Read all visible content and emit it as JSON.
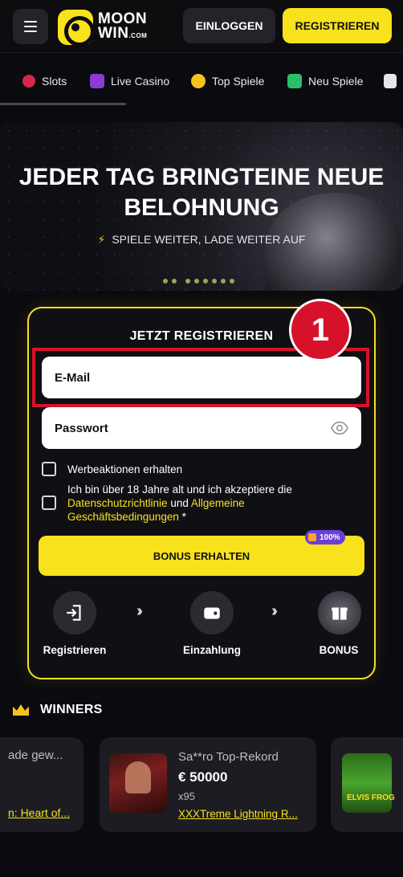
{
  "header": {
    "logo_text": "MOON",
    "logo_text2": "WIN",
    "logo_suffix": ".COM",
    "login_label": "EINLOGGEN",
    "register_label": "REGISTRIEREN"
  },
  "nav": {
    "items": [
      {
        "label": "Slots",
        "icon": "cherries-icon"
      },
      {
        "label": "Live Casino",
        "icon": "play-icon"
      },
      {
        "label": "Top Spiele",
        "icon": "top-games-icon"
      },
      {
        "label": "Neu Spiele",
        "icon": "new-games-icon"
      }
    ]
  },
  "hero": {
    "title_line1": "JEDER TAG BRINGTEINE NEUE",
    "title_line2": "BELOHNUNG",
    "subtitle": "SPIELE WEITER, LADE WEITER AUF",
    "bolt": "⚡"
  },
  "form": {
    "title": "JETZT REGISTRIEREN",
    "email_placeholder": "E-Mail",
    "password_placeholder": "Passwort",
    "promo_label": "Werbeaktionen erhalten",
    "terms_text1": "Ich bin über 18 Jahre alt und ich akzeptiere die",
    "terms_link1": "Datenschutzrichtlinie",
    "terms_and": " und ",
    "terms_link2": "Allgemeine",
    "terms_link3": "Geschäftsbedingungen",
    "terms_star": " *",
    "bonus_button": "BONUS ERHALTEN",
    "bonus_pill": "100%",
    "annotation_number": "1"
  },
  "steps": [
    {
      "label": "Registrieren",
      "icon": "sign-in-icon"
    },
    {
      "label": "Einzahlung",
      "icon": "wallet-icon"
    },
    {
      "label": "BONUS",
      "icon": "gift-icon"
    }
  ],
  "winners": {
    "title": "WINNERS",
    "left_card_line1": "ade gew...",
    "left_card_line2": "n: Heart of...",
    "main_card": {
      "user": "Sa**ro Top-Rekord",
      "amount": "€ 50000",
      "multiplier": "x95",
      "game": "XXXTreme Lightning R..."
    },
    "right_card_label": "ELVIS FROG"
  },
  "colors": {
    "accent": "#f7e21b",
    "annotation_red": "#d6122b",
    "background": "#0b0b0f"
  }
}
